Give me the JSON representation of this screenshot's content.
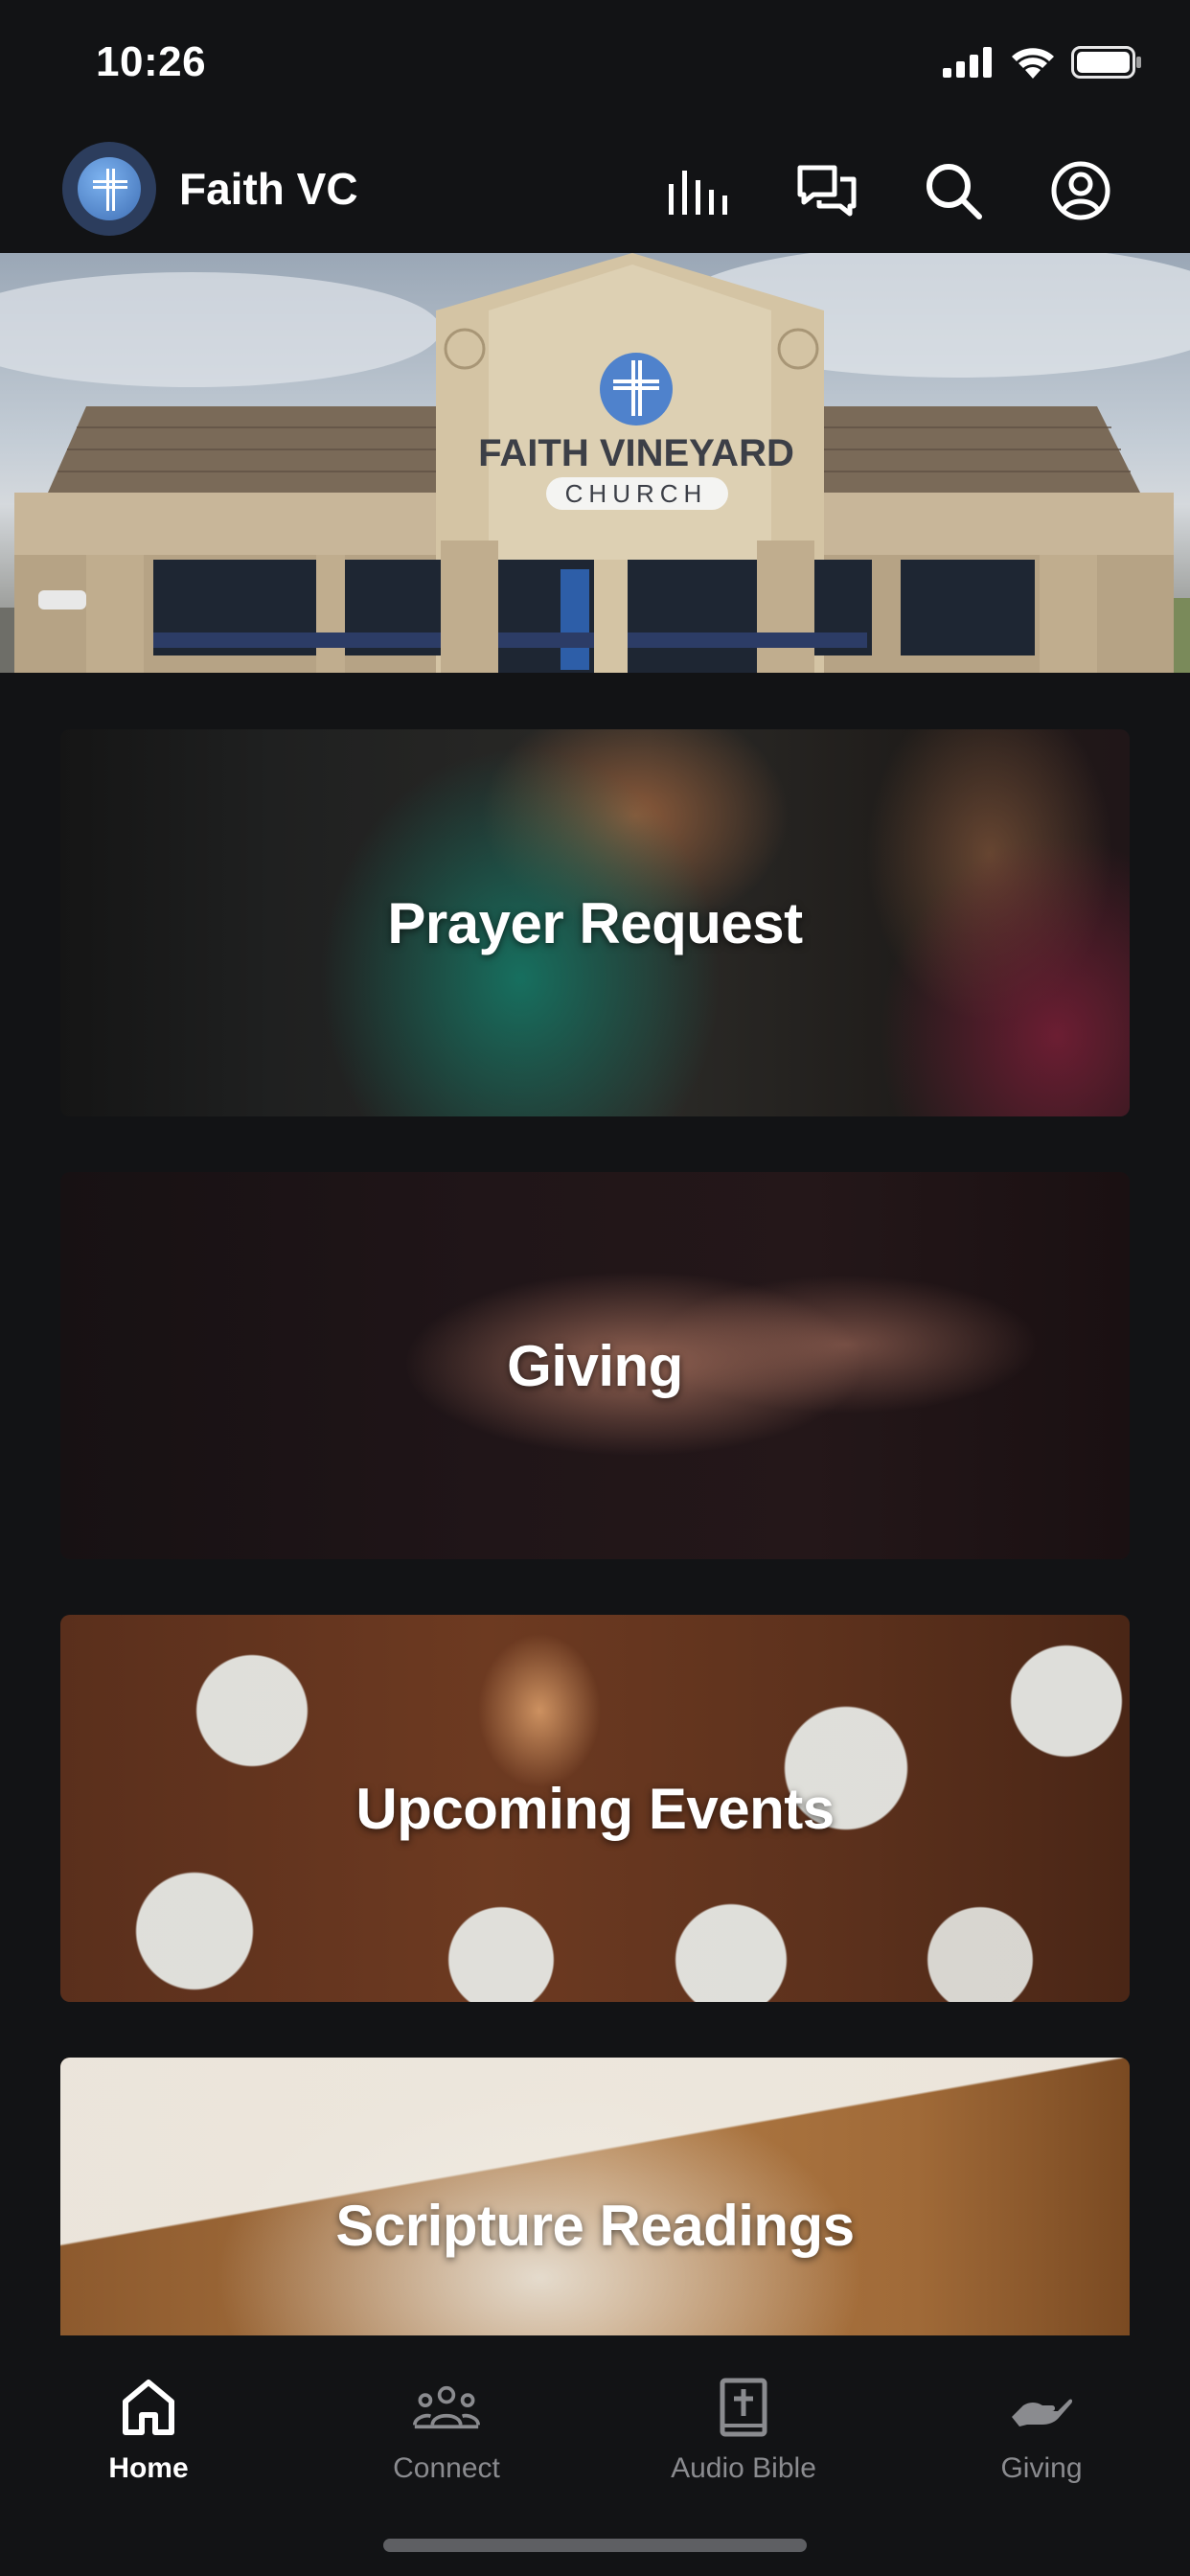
{
  "status_bar": {
    "time": "10:26"
  },
  "header": {
    "app_title": "Faith VC"
  },
  "hero": {
    "sign_line1": "FAITH VINEYARD",
    "sign_line2": "CHURCH"
  },
  "cards": [
    {
      "title": "Prayer Request"
    },
    {
      "title": "Giving"
    },
    {
      "title": "Upcoming Events"
    },
    {
      "title": "Scripture Readings"
    }
  ],
  "tabs": [
    {
      "label": "Home",
      "icon": "home-icon",
      "active": true
    },
    {
      "label": "Connect",
      "icon": "people-icon",
      "active": false
    },
    {
      "label": "Audio Bible",
      "icon": "bible-icon",
      "active": false
    },
    {
      "label": "Giving",
      "icon": "giving-hand-icon",
      "active": false
    }
  ],
  "colors": {
    "background": "#121315",
    "text_primary": "#ffffff",
    "text_inactive": "#8a8b8f",
    "logo_blue": "#5b8fd6"
  }
}
